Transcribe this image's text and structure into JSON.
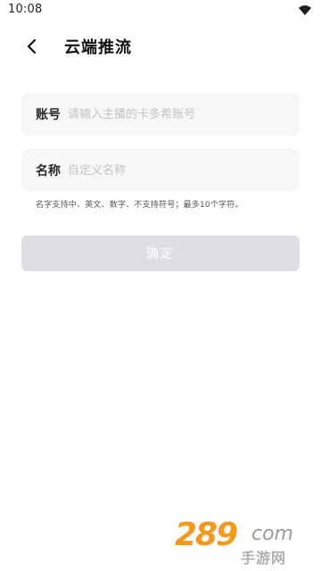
{
  "status_bar": {
    "time": "10:08"
  },
  "header": {
    "title": "云端推流"
  },
  "form": {
    "account": {
      "label": "账号",
      "value": "",
      "placeholder": "请输入主播的卡多希账号"
    },
    "name": {
      "label": "名称",
      "value": "",
      "placeholder": "自定义名称"
    },
    "hint": "名字支持中、英文、数字、不支持符号；最多10个字符。",
    "confirm_label": "确定"
  },
  "watermark": {
    "logo": "289",
    "com": "com",
    "sub": "手游网"
  },
  "colors": {
    "button_disabled": "#dedfe4",
    "field_bg": "#f7f7f8",
    "watermark_orange": "#f39a1e"
  }
}
